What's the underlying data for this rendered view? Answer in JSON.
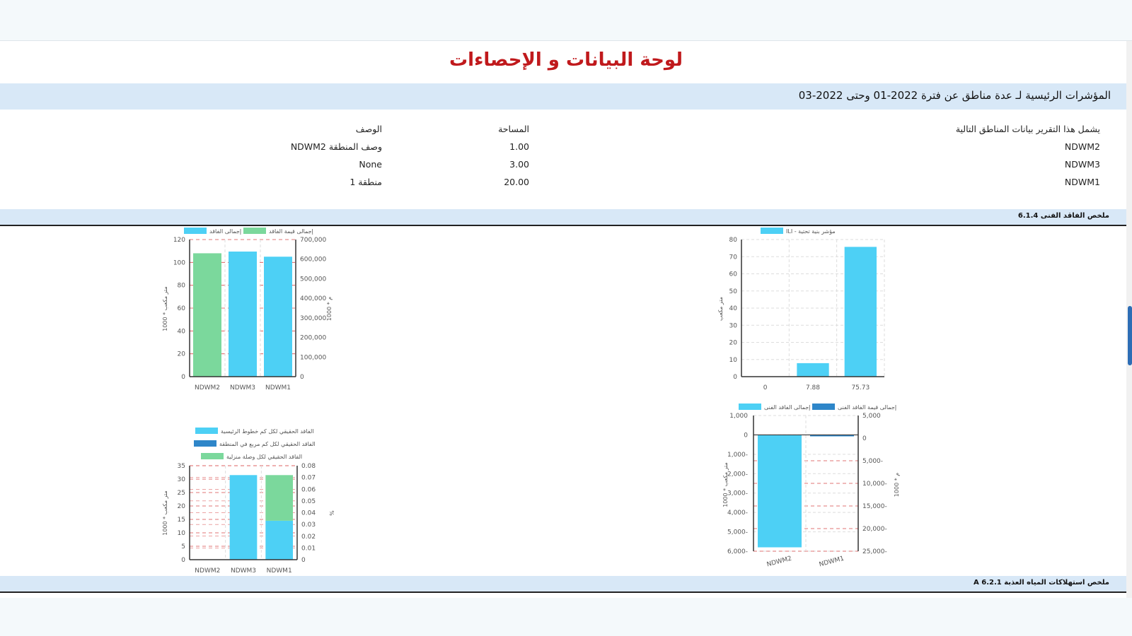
{
  "page": {
    "title": "لوحة البيانات و الإحصاءات",
    "header_band": "المؤشرات الرئيسية لـ عدة مناطق عن فترة 2022-01 وحتى 2022-03",
    "section1": "ملخص الفاقد الفنى 6.1.4",
    "section2": "ملخص استهلاكات المياه العذبة A 6.2.1"
  },
  "areas_table": {
    "intro": "يشمل هذا التقرير بيانات المناطق التالية",
    "area_header": "المساحة",
    "desc_header": "الوصف",
    "rows": [
      {
        "zone": "NDWM2",
        "area": "1.00",
        "desc": "وصف المنطقة NDWM2"
      },
      {
        "zone": "NDWM3",
        "area": "3.00",
        "desc": "None"
      },
      {
        "zone": "NDWM1",
        "area": "20.00",
        "desc": "منطقة 1"
      }
    ]
  },
  "colors": {
    "cyan": "#4dd0f5",
    "green": "#7bd89c",
    "blue": "#2e86c9",
    "grid_red": "#d94a4a",
    "title_red": "#c0191c"
  },
  "chart_data": [
    {
      "id": "ili",
      "type": "bar",
      "legend": [
        "ILI - مؤشر بنية تحتية"
      ],
      "categories": [
        "0",
        "7.88",
        "75.73"
      ],
      "values": [
        0,
        7.88,
        75.73
      ],
      "ylabel": "متر مكعب",
      "ylim": [
        0,
        80
      ],
      "yticks": [
        "0",
        "10",
        "20",
        "30",
        "40",
        "50",
        "60",
        "70",
        "80"
      ],
      "grid": true
    },
    {
      "id": "losses",
      "type": "bar",
      "legend": [
        "إجمالى قيمة الفاقد",
        "إجمالى الفاقد"
      ],
      "categories": [
        "NDWM2",
        "NDWM3",
        "NDWM1"
      ],
      "series": [
        {
          "name": "إجمالى قيمة الفاقد",
          "values": [
            108,
            null,
            null
          ]
        },
        {
          "name": "إجمالى الفاقد",
          "values": [
            null,
            109.5,
            105
          ]
        }
      ],
      "ylabel": "1000 * متر مكعب",
      "y2label": "1000 * م",
      "ylim": [
        0,
        120
      ],
      "y2lim": [
        0,
        700000
      ],
      "yticks": [
        "0",
        "20",
        "40",
        "60",
        "80",
        "100",
        "120"
      ],
      "y2ticks": [
        "0",
        "100,000",
        "200,000",
        "300,000",
        "400,000",
        "500,000",
        "600,000",
        "700,000"
      ],
      "grid": true
    },
    {
      "id": "per_unit",
      "type": "bar",
      "legend": [
        "الفاقد الحقيقي لكل كم خطوط الرئيسية",
        "الفاقد الحقيقي لكل كم مربع في المنطقة",
        "الفاقد الحقيقي لكل وصلة منزلية"
      ],
      "categories": [
        "NDWM2",
        "NDWM3",
        "NDWM1"
      ],
      "series": [
        {
          "name": "الفاقد الحقيقي لكل كم خطوط الرئيسية",
          "values": [
            0,
            31.5,
            14.5
          ]
        },
        {
          "name": "الفاقد الحقيقي لكل وصلة منزلية",
          "values": [
            0,
            0,
            17
          ]
        }
      ],
      "ylabel": "1000 * متر مكعب",
      "y2label": "%",
      "ylim": [
        0,
        35
      ],
      "y2lim": [
        0,
        0.08
      ],
      "yticks": [
        "0",
        "5",
        "10",
        "15",
        "20",
        "25",
        "30",
        "35"
      ],
      "y2ticks": [
        "0",
        "0.01",
        "0.02",
        "0.03",
        "0.04",
        "0.05",
        "0.06",
        "0.07",
        "0.08"
      ],
      "grid": true
    },
    {
      "id": "negative",
      "type": "bar",
      "legend": [
        "إجمالى قيمة الفاقد الفنى",
        "إجمالى الفاقد الفنى"
      ],
      "categories": [
        "NDWM2",
        "NDWM1"
      ],
      "series": [
        {
          "name": "إجمالى الفاقد الفنى",
          "values": [
            -5800,
            -20
          ]
        },
        {
          "name": "إجمالى قيمة الفاقد الفنى",
          "values": [
            null,
            -60
          ]
        }
      ],
      "ylabel": "1000 * متر مكعب",
      "y2label": "1000 * م",
      "ylim": [
        -6000,
        1000
      ],
      "y2lim": [
        -25000,
        5000
      ],
      "yticks": [
        "1,000",
        "0",
        "1,000-",
        "2,000-",
        "3,000-",
        "4,000-",
        "5,000-",
        "6,000-"
      ],
      "y2ticks": [
        "5,000",
        "0",
        "5,000-",
        "10,000-",
        "15,000-",
        "20,000-",
        "25,000-"
      ],
      "grid": true
    }
  ]
}
